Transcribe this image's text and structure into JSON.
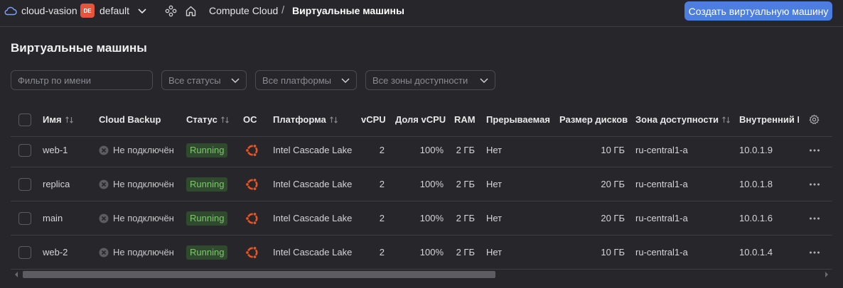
{
  "header": {
    "cloud_name": "cloud-vasion",
    "folder_badge": "DE",
    "folder_name": "default",
    "breadcrumb_service": "Compute Cloud",
    "breadcrumb_separator": "/",
    "breadcrumb_current": "Виртуальные машины",
    "create_button": "Создать виртуальную машину",
    "badge_color": "#e5553a",
    "accent_color": "#4c7ee0"
  },
  "page": {
    "title": "Виртуальные машины"
  },
  "filters": {
    "name_placeholder": "Фильтр по имени",
    "status_value": "Все статусы",
    "platform_value": "Все платформы",
    "zone_value": "Все зоны доступности"
  },
  "table": {
    "columns": {
      "name": "Имя",
      "backup": "Cloud Backup",
      "status": "Статус",
      "os": "ОС",
      "platform": "Платформа",
      "vcpu": "vCPU",
      "vcpu_share": "Доля vCPU",
      "ram": "RAM",
      "preemptible": "Прерываемая",
      "disk_size": "Размер дисков",
      "zone": "Зона доступности",
      "internal_ip": "Внутренний IP"
    },
    "rows": [
      {
        "name": "web-1",
        "backup": "Не подключён",
        "status": "Running",
        "os_icon": "ubuntu-icon",
        "platform": "Intel Cascade Lake",
        "vcpu": "2",
        "vcpu_share": "100%",
        "ram": "2 ГБ",
        "preemptible": "Нет",
        "disk_size": "10 ГБ",
        "zone": "ru-central1-a",
        "internal_ip": "10.0.1.9"
      },
      {
        "name": "replica",
        "backup": "Не подключён",
        "status": "Running",
        "os_icon": "ubuntu-icon",
        "platform": "Intel Cascade Lake",
        "vcpu": "2",
        "vcpu_share": "100%",
        "ram": "2 ГБ",
        "preemptible": "Нет",
        "disk_size": "20 ГБ",
        "zone": "ru-central1-a",
        "internal_ip": "10.0.1.8"
      },
      {
        "name": "main",
        "backup": "Не подключён",
        "status": "Running",
        "os_icon": "ubuntu-icon",
        "platform": "Intel Cascade Lake",
        "vcpu": "2",
        "vcpu_share": "100%",
        "ram": "2 ГБ",
        "preemptible": "Нет",
        "disk_size": "20 ГБ",
        "zone": "ru-central1-a",
        "internal_ip": "10.0.1.6"
      },
      {
        "name": "web-2",
        "backup": "Не подключён",
        "status": "Running",
        "os_icon": "ubuntu-icon",
        "platform": "Intel Cascade Lake",
        "vcpu": "2",
        "vcpu_share": "100%",
        "ram": "2 ГБ",
        "preemptible": "Нет",
        "disk_size": "10 ГБ",
        "zone": "ru-central1-a",
        "internal_ip": "10.0.1.4"
      }
    ]
  },
  "colors": {
    "status_running_bg": "#2f4a2c",
    "status_running_text": "#7bc86c",
    "ubuntu_orange": "#e95420"
  }
}
